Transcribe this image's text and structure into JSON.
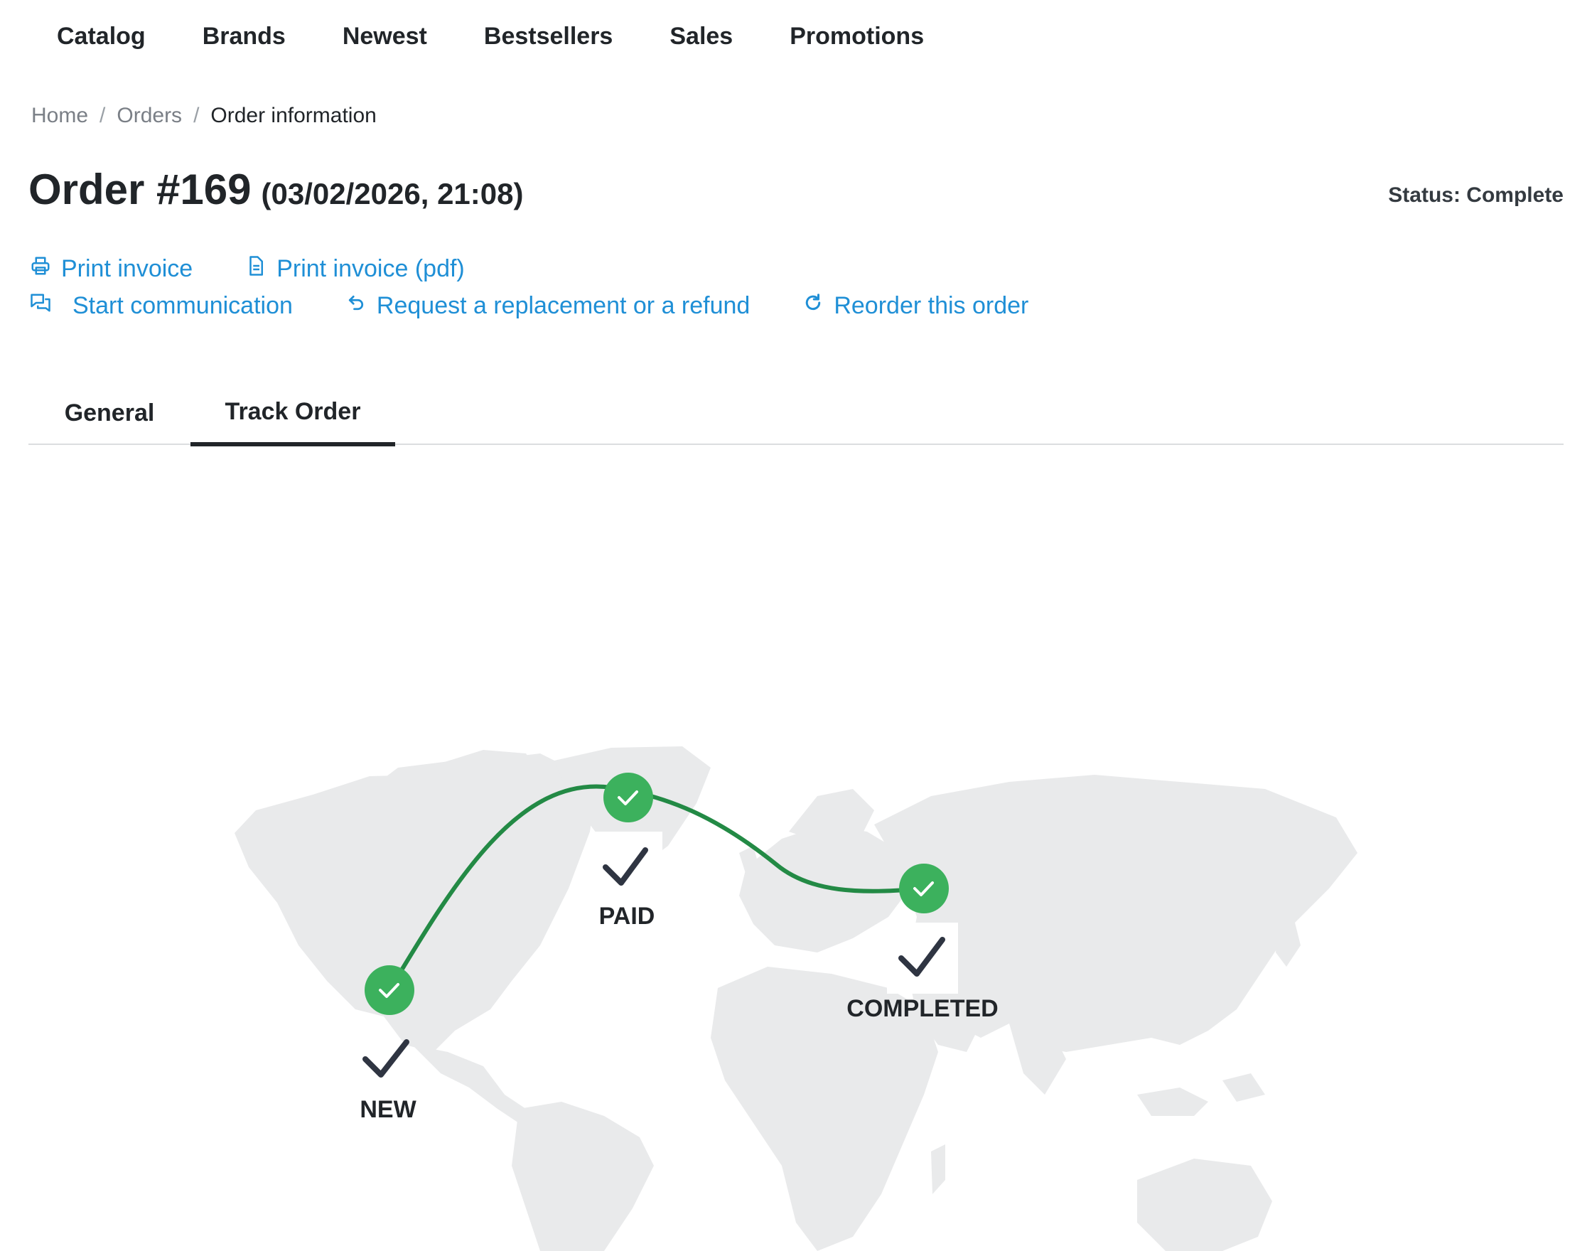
{
  "nav": {
    "items": [
      {
        "label": "Catalog"
      },
      {
        "label": "Brands"
      },
      {
        "label": "Newest"
      },
      {
        "label": "Bestsellers"
      },
      {
        "label": "Sales"
      },
      {
        "label": "Promotions"
      }
    ]
  },
  "breadcrumb": {
    "home": "Home",
    "orders": "Orders",
    "current": "Order information",
    "separator": "/"
  },
  "order": {
    "title": "Order #169",
    "date": "(03/02/2026, 21:08)",
    "status": "Status: Complete"
  },
  "actions": {
    "print_invoice": {
      "label": "Print invoice",
      "icon": "printer-icon"
    },
    "print_invoice_pdf": {
      "label": "Print invoice (pdf)",
      "icon": "document-icon"
    },
    "start_communication": {
      "label": "Start communication",
      "icon": "chat-icon"
    },
    "request_refund": {
      "label": "Request a replacement or a refund",
      "icon": "undo-icon"
    },
    "reorder": {
      "label": "Reorder this order",
      "icon": "refresh-icon"
    }
  },
  "tabs": [
    {
      "label": "General",
      "active": false
    },
    {
      "label": "Track Order",
      "active": true
    }
  ],
  "tracking": {
    "stages": [
      {
        "label": "NEW",
        "done": true
      },
      {
        "label": "PAID",
        "done": true
      },
      {
        "label": "COMPLETED",
        "done": true
      }
    ]
  },
  "colors": {
    "link": "#1f8fd6",
    "route": "#238a45",
    "stage_done": "#3cb15d",
    "map_land": "#e9eaeb"
  }
}
